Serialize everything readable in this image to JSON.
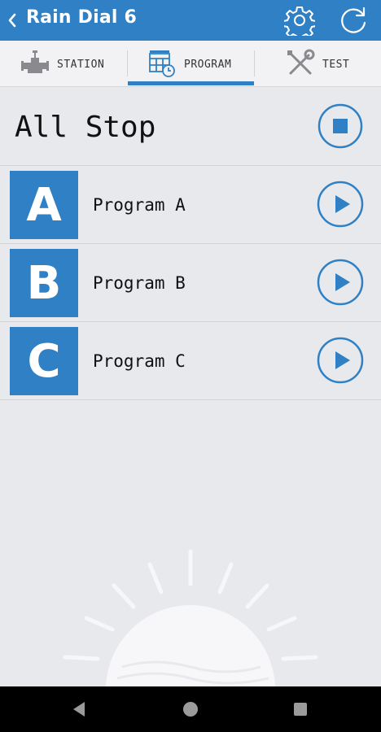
{
  "header": {
    "title": "Rain Dial 6",
    "back_icon": "chevron-left-icon",
    "settings_icon": "gear-icon",
    "refresh_icon": "refresh-icon"
  },
  "tabs": [
    {
      "label": "STATION",
      "icon": "valve-icon",
      "selected": false
    },
    {
      "label": "PROGRAM",
      "icon": "calendar-clock-icon",
      "selected": true
    },
    {
      "label": "TEST",
      "icon": "wrench-screwdriver-icon",
      "selected": false
    }
  ],
  "all_stop": {
    "label": "All Stop",
    "icon": "stop-icon"
  },
  "programs": [
    {
      "letter": "A",
      "name": "Program A",
      "icon": "play-icon"
    },
    {
      "letter": "B",
      "name": "Program B",
      "icon": "play-icon"
    },
    {
      "letter": "C",
      "name": "Program C",
      "icon": "play-icon"
    }
  ],
  "colors": {
    "accent": "#2f80c4",
    "background": "#e8e9ec",
    "tabbar": "#f2f2f4"
  },
  "navbar": {
    "back": "nav-back-icon",
    "home": "nav-home-icon",
    "recent": "nav-recent-icon"
  }
}
